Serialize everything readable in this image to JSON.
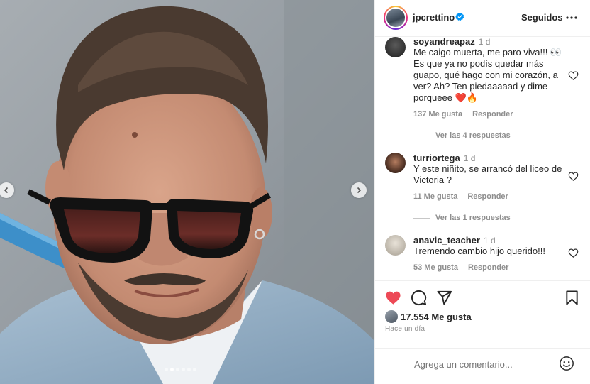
{
  "media": {
    "carousel_dots": 6,
    "active_dot": 1,
    "prev_icon": "chevron-left-icon",
    "next_icon": "chevron-right-icon"
  },
  "header": {
    "username": "jpcrettino",
    "verified": true,
    "follow_label": "Seguidos",
    "more_icon": "more-horizontal-icon"
  },
  "comments": [
    {
      "user": "soyandreapaz",
      "time": "1 d",
      "text": "Me caigo muerta, me paro viva!!! 👀 Es que ya no podís quedar más guapo, qué hago con mi corazón, a ver? Ah? Ten piedaaaaad y dime porqueee ❤️🔥",
      "likes": "137 Me gusta",
      "reply_label": "Responder",
      "replies": "Ver las 4 respuestas"
    },
    {
      "user": "turriortega",
      "time": "1 d",
      "text": "Y este niñito, se arrancó del liceo de Victoria ?",
      "likes": "11 Me gusta",
      "reply_label": "Responder",
      "replies": "Ver las 1 respuestas"
    },
    {
      "user": "anavic_teacher",
      "time": "1 d",
      "text": "Tremendo cambio hijo querido!!!",
      "likes": "53 Me gusta",
      "reply_label": "Responder"
    }
  ],
  "actions": {
    "like_icon": "heart-filled-icon",
    "comment_icon": "comment-icon",
    "share_icon": "send-icon",
    "save_icon": "bookmark-icon",
    "like_color": "#ed4956"
  },
  "likes_count": "17.554 Me gusta",
  "post_time": "Hace un día",
  "add_comment": {
    "placeholder": "Agrega un comentario...",
    "emoji_icon": "emoji-icon"
  }
}
